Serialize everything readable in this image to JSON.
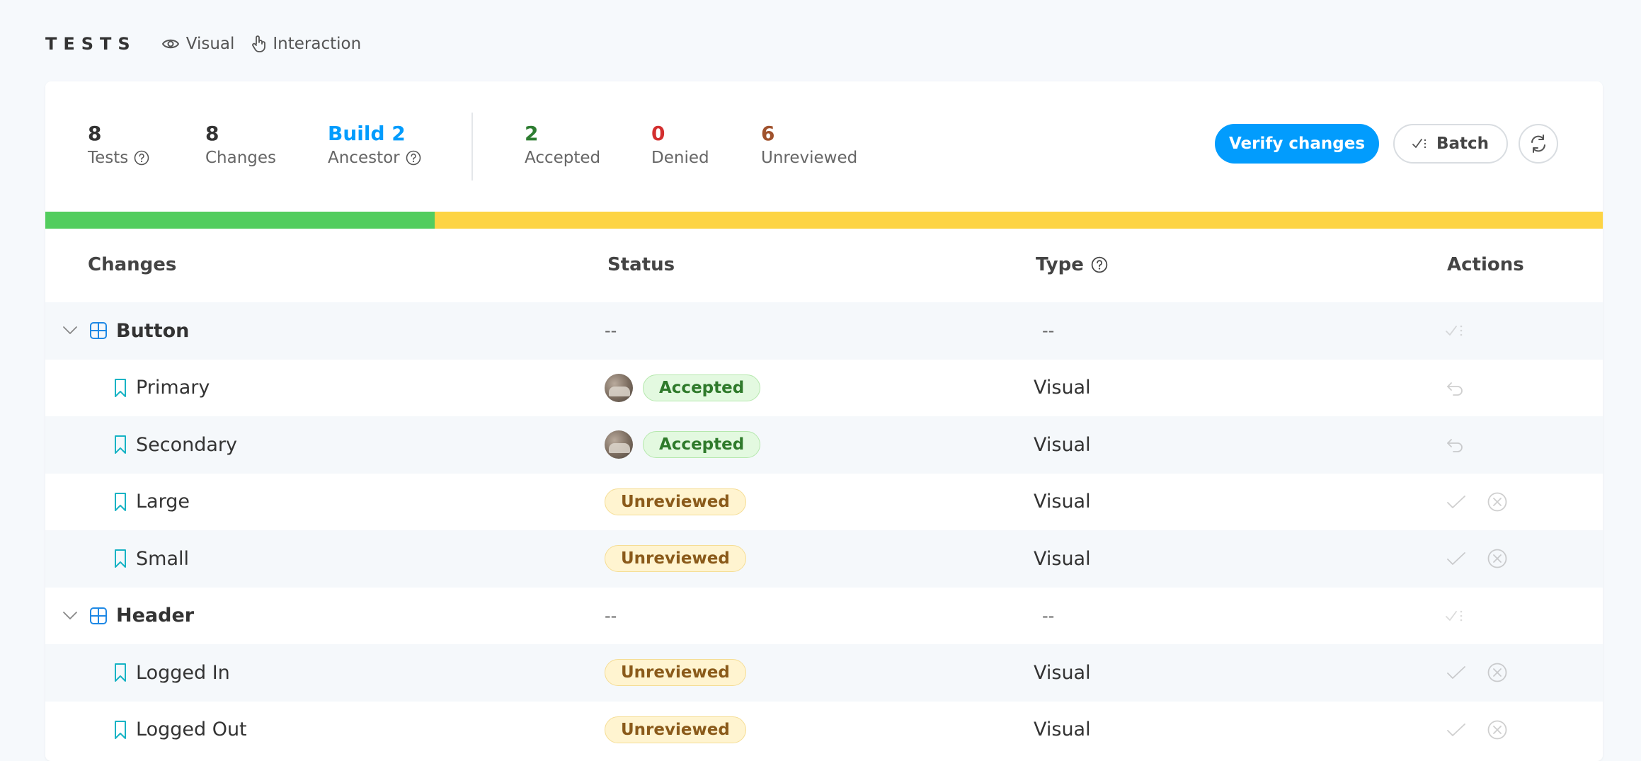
{
  "app": {
    "brand": "TESTS",
    "nav": [
      {
        "label": "Visual",
        "icon": "eye-icon"
      },
      {
        "label": "Interaction",
        "icon": "pointer-hand-icon"
      }
    ]
  },
  "summary": {
    "tests": {
      "value": "8",
      "label": "Tests"
    },
    "changes": {
      "value": "8",
      "label": "Changes"
    },
    "ancestor": {
      "value": "Build 2",
      "label": "Ancestor"
    },
    "accepted": {
      "value": "2",
      "label": "Accepted"
    },
    "denied": {
      "value": "0",
      "label": "Denied"
    },
    "unreviewed": {
      "value": "6",
      "label": "Unreviewed"
    }
  },
  "actions": {
    "verify_label": "Verify changes",
    "batch_label": "Batch"
  },
  "progress": {
    "accepted_fraction": 0.25,
    "unreviewed_fraction": 0.75
  },
  "colors": {
    "accent": "#029cfd",
    "accepted": "#2e7d32",
    "denied": "#d32f2f",
    "unreviewed": "#a0522d",
    "progress_green": "#52cd5e",
    "progress_yellow": "#fdd444"
  },
  "table": {
    "headers": {
      "changes": "Changes",
      "status": "Status",
      "type": "Type",
      "actions": "Actions"
    },
    "rows": [
      {
        "kind": "group",
        "name": "Button",
        "status": "--",
        "type": "--"
      },
      {
        "kind": "story",
        "name": "Primary",
        "status": "Accepted",
        "type": "Visual"
      },
      {
        "kind": "story",
        "name": "Secondary",
        "status": "Accepted",
        "type": "Visual"
      },
      {
        "kind": "story",
        "name": "Large",
        "status": "Unreviewed",
        "type": "Visual"
      },
      {
        "kind": "story",
        "name": "Small",
        "status": "Unreviewed",
        "type": "Visual"
      },
      {
        "kind": "group",
        "name": "Header",
        "status": "--",
        "type": "--"
      },
      {
        "kind": "story",
        "name": "Logged In",
        "status": "Unreviewed",
        "type": "Visual"
      },
      {
        "kind": "story",
        "name": "Logged Out",
        "status": "Unreviewed",
        "type": "Visual"
      }
    ]
  }
}
